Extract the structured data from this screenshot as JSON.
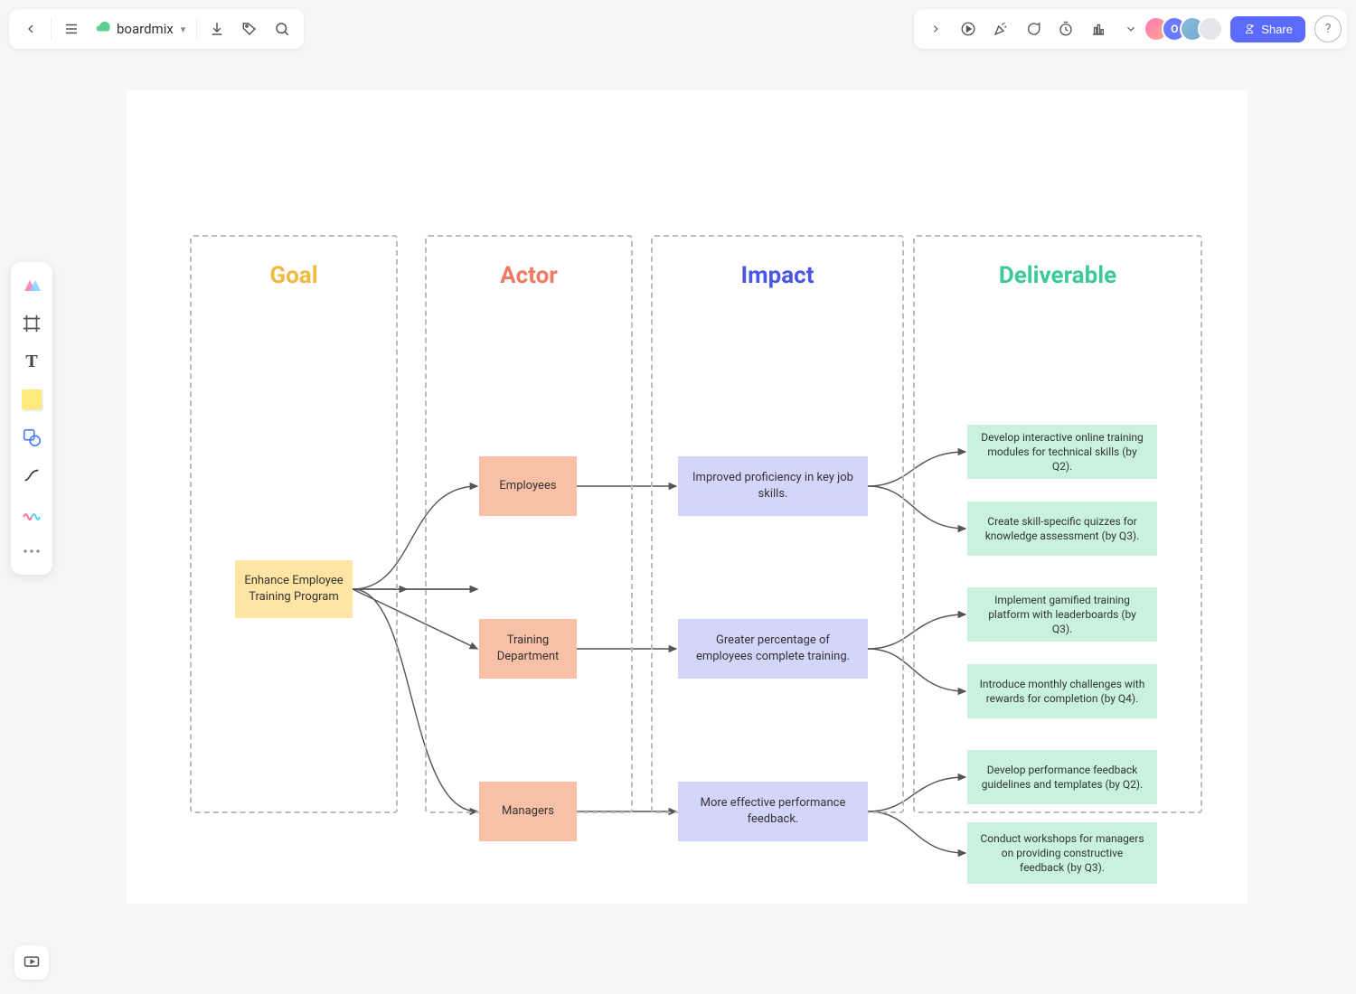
{
  "brand": "boardmix",
  "share_label": "Share",
  "avatars": {
    "a2_initial": "O"
  },
  "columns": {
    "goal": "Goal",
    "actor": "Actor",
    "impact": "Impact",
    "deliverable": "Deliverable"
  },
  "nodes": {
    "goal": "Enhance Employee Training Program",
    "actors": {
      "a1": "Employees",
      "a2": "Training Department",
      "a3": "Managers"
    },
    "impacts": {
      "i1": "Improved proficiency in key job skills.",
      "i2": "Greater percentage of employees complete training.",
      "i3": "More effective performance feedback."
    },
    "deliverables": {
      "d1": "Develop interactive online training modules for technical skills (by Q2).",
      "d2": "Create skill-specific quizzes for knowledge assessment (by Q3).",
      "d3": "Implement gamified training platform with leaderboards (by Q3).",
      "d4": "Introduce monthly challenges with rewards for completion (by Q4).",
      "d5": "Develop performance feedback guidelines and templates (by Q2).",
      "d6": "Conduct workshops for managers on providing constructive feedback (by Q3)."
    }
  }
}
